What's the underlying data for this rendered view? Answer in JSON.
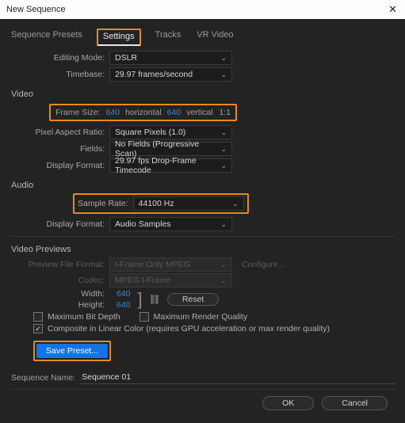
{
  "window": {
    "title": "New Sequence"
  },
  "tabs": {
    "presets": "Sequence Presets",
    "settings": "Settings",
    "tracks": "Tracks",
    "vr": "VR Video"
  },
  "settings": {
    "editing_mode_label": "Editing Mode:",
    "editing_mode_value": "DSLR",
    "timebase_label": "Timebase:",
    "timebase_value": "29.97 frames/second"
  },
  "video": {
    "section": "Video",
    "frame_size_label": "Frame Size:",
    "frame_w": "640",
    "horizontal": "horizontal",
    "frame_h": "640",
    "vertical": "vertical",
    "ratio": "1:1",
    "par_label": "Pixel Aspect Ratio:",
    "par_value": "Square Pixels (1.0)",
    "fields_label": "Fields:",
    "fields_value": "No Fields (Progressive Scan)",
    "display_format_label": "Display Format:",
    "display_format_value": "29.97 fps Drop-Frame Timecode"
  },
  "audio": {
    "section": "Audio",
    "sample_rate_label": "Sample Rate:",
    "sample_rate_value": "44100 Hz",
    "display_format_label": "Display Format:",
    "display_format_value": "Audio Samples"
  },
  "previews": {
    "section": "Video Previews",
    "preview_format_label": "Preview File Format:",
    "preview_format_value": "I-Frame Only MPEG",
    "codec_label": "Codec:",
    "codec_value": "MPEG I-Frame",
    "configure": "Configure...",
    "width_label": "Width:",
    "width_value": "640",
    "height_label": "Height:",
    "height_value": "640",
    "reset": "Reset"
  },
  "options": {
    "max_bit_depth": "Maximum Bit Depth",
    "max_render_quality": "Maximum Render Quality",
    "composite_linear": "Composite in Linear Color (requires GPU acceleration or max render quality)"
  },
  "actions": {
    "save_preset": "Save Preset...",
    "ok": "OK",
    "cancel": "Cancel"
  },
  "sequence": {
    "name_label": "Sequence Name:",
    "name_value": "Sequence 01"
  }
}
